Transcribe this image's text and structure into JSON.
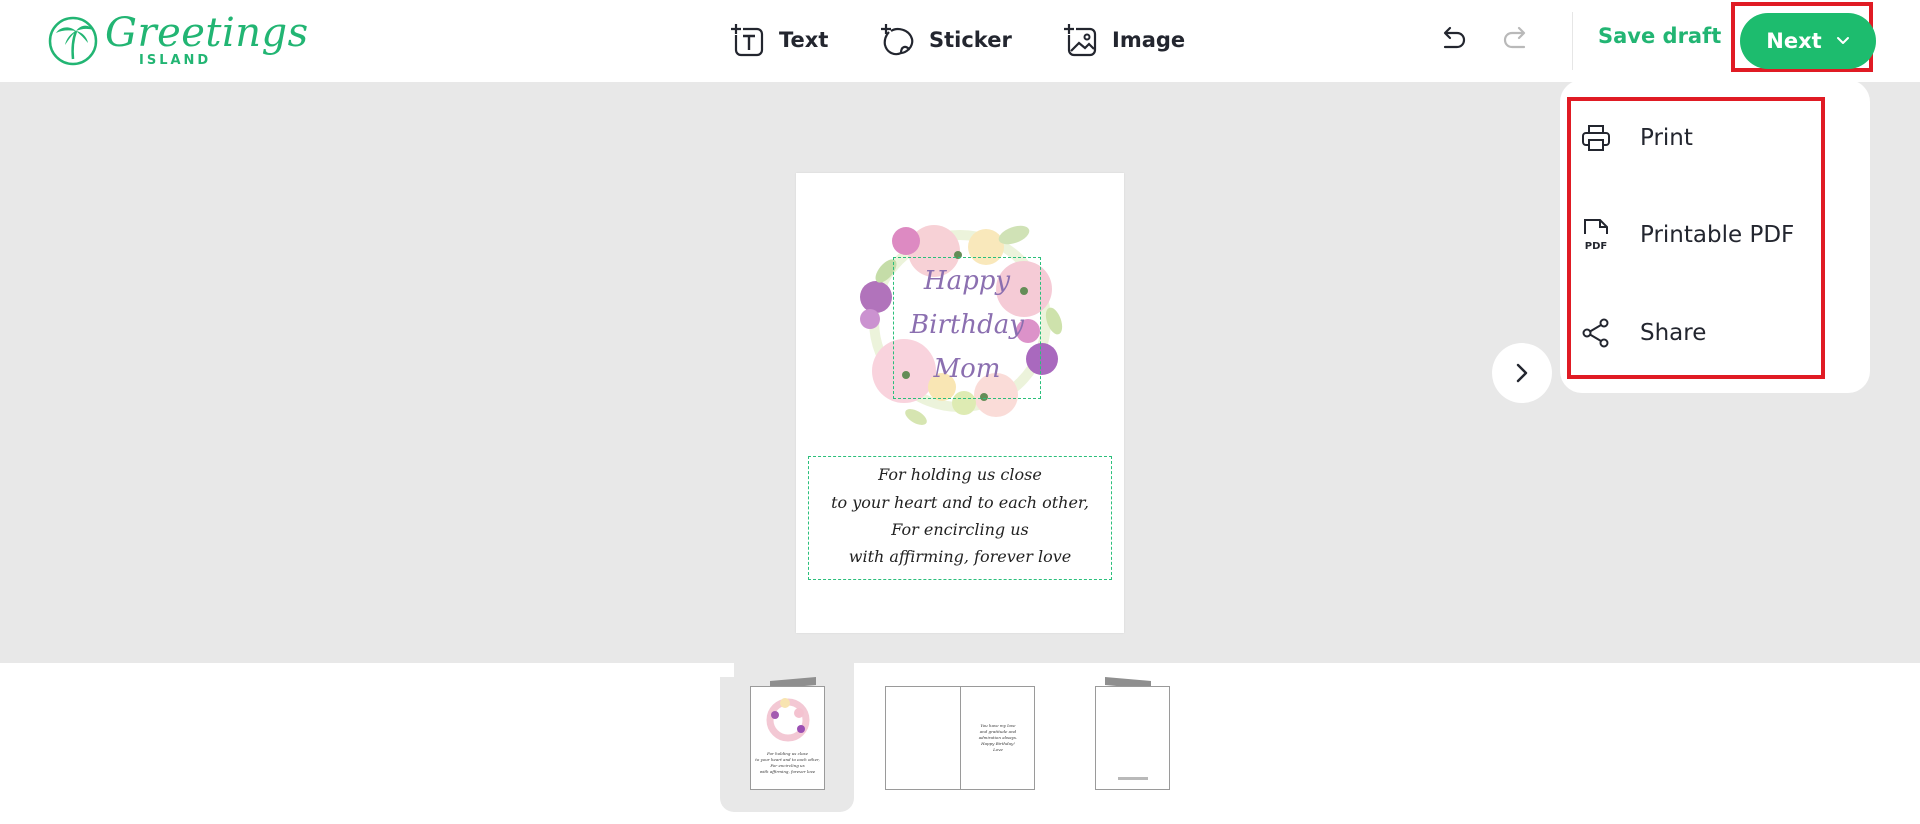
{
  "brand": {
    "name": "Greetings",
    "sub": "ISLAND",
    "color": "#22b573"
  },
  "toolbar": {
    "text_label": "Text",
    "sticker_label": "Sticker",
    "image_label": "Image",
    "save_draft_label": "Save draft",
    "next_label": "Next"
  },
  "card": {
    "title_lines": [
      "Happy",
      "Birthday",
      "Mom"
    ],
    "verse_lines": [
      "For holding us close",
      "to your heart and to each other,",
      "For encircling us",
      "with affirming, forever love"
    ]
  },
  "dropdown": {
    "items": [
      {
        "label": "Print",
        "icon": "printer-icon"
      },
      {
        "label": "Printable PDF",
        "icon": "pdf-file-icon"
      },
      {
        "label": "Share",
        "icon": "share-icon"
      }
    ]
  },
  "pages": {
    "count": 3,
    "selected_index": 0,
    "inside_text_lines": [
      "You have my love",
      "and gratitude and",
      "admiration always.",
      "Happy Birthday!",
      "Love"
    ]
  },
  "colors": {
    "accent": "#1dbc6e",
    "highlight": "#e01b24",
    "canvas_bg": "#e8e8e8"
  }
}
